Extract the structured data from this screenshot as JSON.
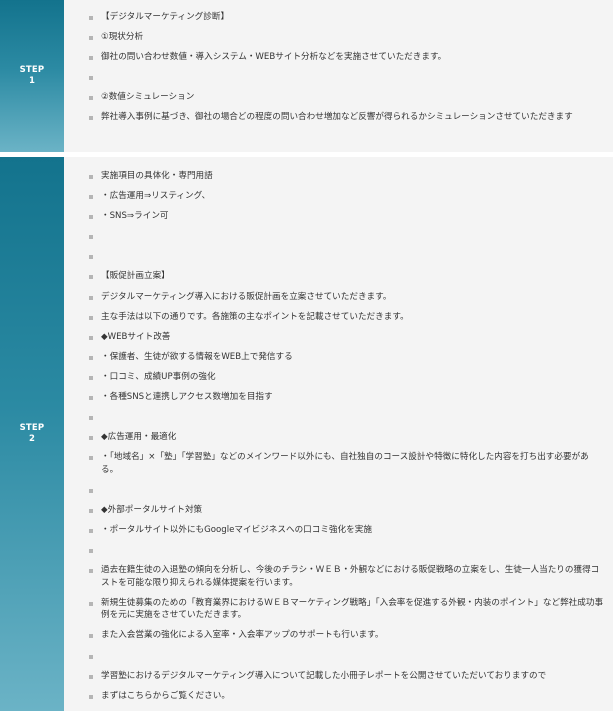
{
  "steps": [
    {
      "label_top": "STEP",
      "label_num": "1",
      "items": [
        "【デジタルマーケティング診断】",
        "①現状分析",
        "御社の問い合わせ数値・導入システム・WEBサイト分析などを実施させていただきます。",
        "",
        "②数値シミュレーション",
        "弊社導入事例に基づき、御社の場合どの程度の問い合わせ増加など反響が得られるかシミュレーションさせていただきます"
      ]
    },
    {
      "label_top": "STEP",
      "label_num": "2",
      "items": [
        "実施項目の具体化・専門用語",
        "・広告運用⇒リスティング、",
        "・SNS⇒ライン可",
        "",
        "",
        "【販促計画立案】",
        "デジタルマーケティング導入における販促計画を立案させていただきます。",
        "主な手法は以下の通りです。各施策の主なポイントを記載させていただきます。",
        "◆WEBサイト改善",
        "・保護者、生徒が欲する情報をWEB上で発信する",
        "・口コミ、成績UP事例の強化",
        "・各種SNSと連携しアクセス数増加を目指す",
        "",
        "◆広告運用・最適化",
        "・「地域名」×「塾」「学習塾」などのメインワード以外にも、自社独自のコース設計や特徴に特化した内容を打ち出す必要がある。",
        "",
        "◆外部ポータルサイト対策",
        "・ポータルサイト以外にもGoogleマイビジネスへの口コミ強化を実施",
        "",
        "過去在籍生徒の入退塾の傾向を分析し、今後のチラシ・ＷＥＢ・外観などにおける販促戦略の立案をし、生徒一人当たりの獲得コストを可能な限り抑えられる媒体提案を行います。",
        "新規生徒募集のための「教育業界におけるＷＥＢマーケティング戦略」「入会率を促進する外観・内装のポイント」など弊社成功事例を元に実施をさせていただきます。",
        "また入会営業の強化による入室率・入会率アップのサポートも行います。",
        "",
        "学習塾におけるデジタルマーケティング導入について記載した小冊子レポートを公開させていただいておりますので",
        "まずはこちらからご覧ください。"
      ]
    }
  ]
}
